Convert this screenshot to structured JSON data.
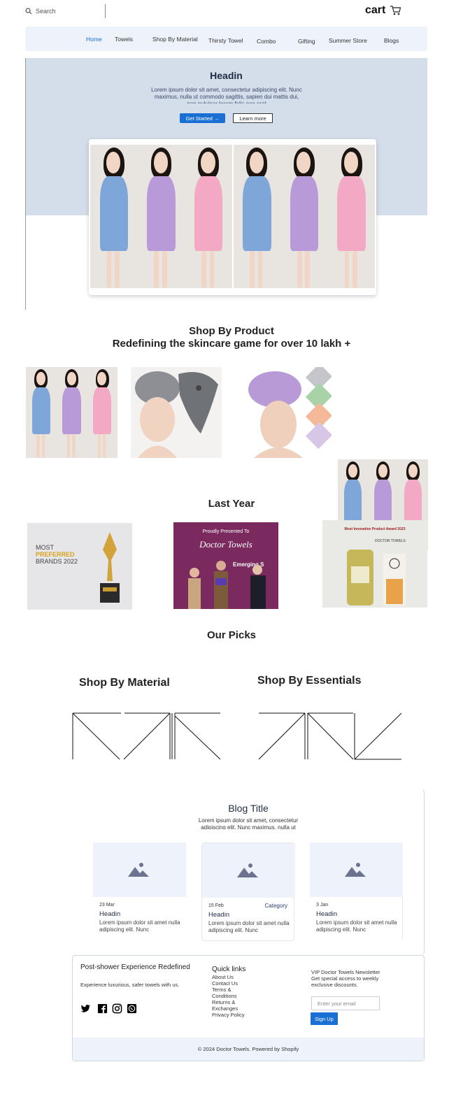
{
  "header": {
    "search_placeholder": "Search",
    "cart_label": "cart"
  },
  "nav": {
    "items": [
      "Home",
      "Towels",
      "Shop By Material",
      "Thirsty Towel",
      "Combo",
      "Gifting",
      "Summer Store",
      "Blogs"
    ]
  },
  "hero": {
    "title": "Headin",
    "text": "Lorem ipsum dolor sit amet, consectetur adipiscing elit. Nunc maximus, nulla ut commodo sagittis, sapien dui mattis dui, non pulvinar lorem felis nec erat",
    "primary_button": "Get Started",
    "secondary_button": "Learn more"
  },
  "shop_by_product": {
    "title": "Shop By Product",
    "subtitle": "Redefining the skincare game for over 10 lakh +"
  },
  "last_year": {
    "title": "Last Year",
    "award1_lines": [
      "MOST",
      "PREFERRED",
      "BRANDS 2022"
    ],
    "award2_lines": [
      "Proudly Presented To",
      "Doctor Towels",
      "Emerging S"
    ],
    "award3_lines": [
      "Most Innovative Product Award 2023",
      "DOCTOR TOWELS"
    ]
  },
  "our_picks": {
    "title": "Our Picks",
    "material_heading": "Shop By Material",
    "essentials_heading": "Shop By Essentials"
  },
  "blog": {
    "title": "Blog Title",
    "intro": "Lorem ipsum dolor sit amet, consectetur adipiscing elit. Nunc maximus, nulla ut",
    "cards": [
      {
        "date": "23 Mar",
        "category": "",
        "title": "Headin",
        "text": "Lorem ipsum dolor sit amet nulla adipiscing elit. Nunc"
      },
      {
        "date": "15 Feb",
        "category": "Category",
        "title": "Headin",
        "text": "Lorem ipsum dolor sit amet nulla adipiscing elit. Nunc"
      },
      {
        "date": "3 Jan",
        "category": "",
        "title": "Headin",
        "text": "Lorem ipsum dolor sit amet nulla adipiscing elit. Nunc"
      }
    ]
  },
  "footer": {
    "title": "Post-shower Experience Redefined",
    "subtitle": "Experience luxurious, safer towels with us.",
    "quick_links_title": "Quick links",
    "quick_links": [
      "About Us",
      "Contact Us",
      "Terms & Conditions",
      "Returns & Exchanges",
      "Privacy Policy"
    ],
    "newsletter_title": "VIP Doctor Towels Newsletter",
    "newsletter_text": "Get special access to weekly exclusive discounts.",
    "email_placeholder": "Enter your email",
    "signup_button": "Sign Up",
    "copyright": "© 2024 Doctor Towels. Powered by Shopify",
    "social_icons": [
      "twitter-icon",
      "facebook-icon",
      "instagram-icon",
      "whatsapp-icon"
    ]
  },
  "colors": {
    "accent": "#1a6fd4",
    "hero_bg": "#d4ddea",
    "nav_bg": "#eef2fa",
    "towel_blue": "#7fa6d8",
    "towel_purple": "#b99ad8",
    "towel_pink": "#f3a9c4"
  }
}
